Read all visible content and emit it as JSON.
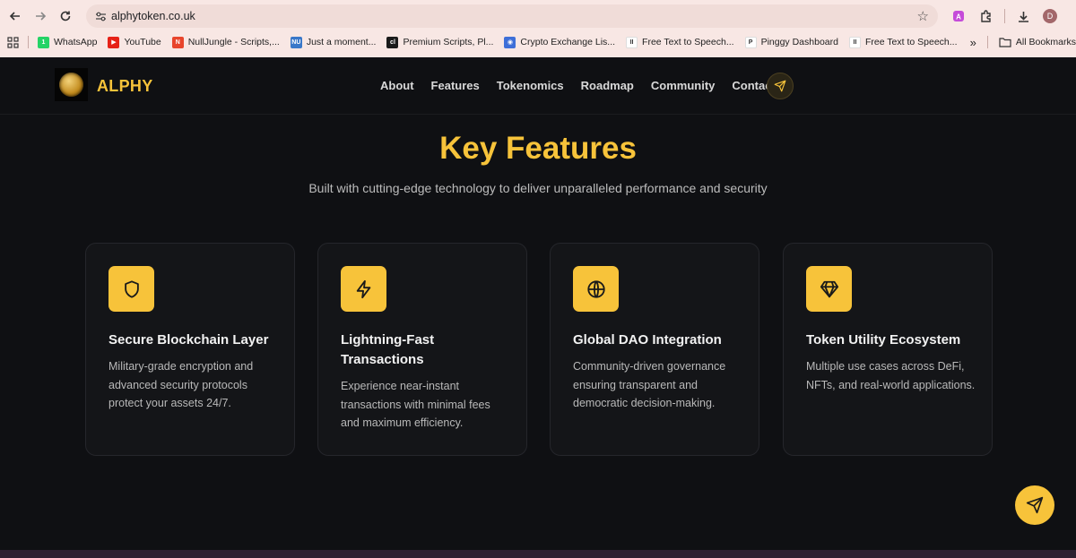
{
  "browser": {
    "url": "alphytoken.co.uk",
    "profile_initial": "D",
    "bookmarks": [
      {
        "label": "WhatsApp",
        "icon": "whatsapp-icon",
        "color": "#25d366",
        "glyph": "1"
      },
      {
        "label": "YouTube",
        "icon": "youtube-icon",
        "color": "#e62117",
        "glyph": "▶"
      },
      {
        "label": "NullJungle - Scripts,...",
        "icon": "nulljungle-icon",
        "color": "#e8452c",
        "glyph": "N"
      },
      {
        "label": "Just a moment...",
        "icon": "nu-icon",
        "color": "#3a78c9",
        "glyph": "NU"
      },
      {
        "label": "Premium Scripts, Pl...",
        "icon": "cl-icon",
        "color": "#1a1a1a",
        "glyph": "cl"
      },
      {
        "label": "Crypto Exchange Lis...",
        "icon": "globe-icon",
        "color": "#3e6fd8",
        "glyph": "◉"
      },
      {
        "label": "Free Text to Speech...",
        "icon": "tts-icon",
        "color": "#ffffff",
        "glyph": "II"
      },
      {
        "label": "Pinggy Dashboard",
        "icon": "pinggy-icon",
        "color": "#ffffff",
        "glyph": "P"
      },
      {
        "label": "Free Text to Speech...",
        "icon": "tts-icon",
        "color": "#ffffff",
        "glyph": "II"
      }
    ],
    "all_bookmarks_label": "All Bookmarks",
    "overflow_label": "»"
  },
  "site": {
    "brand": "ALPHY",
    "menu": [
      "About",
      "Features",
      "Tokenomics",
      "Roadmap",
      "Community",
      "Contact"
    ],
    "section_title": "Key Features",
    "section_subtitle": "Built with cutting-edge technology to deliver unparalleled performance and security",
    "features": [
      {
        "icon": "shield-icon",
        "title": "Secure Blockchain Layer",
        "description": "Military-grade encryption and advanced security protocols protect your assets 24/7."
      },
      {
        "icon": "lightning-icon",
        "title": "Lightning-Fast Transactions",
        "description": "Experience near-instant transactions with minimal fees and maximum efficiency."
      },
      {
        "icon": "globe-icon",
        "title": "Global DAO Integration",
        "description": "Community-driven governance ensuring transparent and democratic decision-making."
      },
      {
        "icon": "diamond-icon",
        "title": "Token Utility Ecosystem",
        "description": "Multiple use cases across DeFi, NFTs, and real-world applications."
      }
    ]
  },
  "colors": {
    "accent": "#f7c33a",
    "background": "#0f1013",
    "card": "#141518"
  }
}
